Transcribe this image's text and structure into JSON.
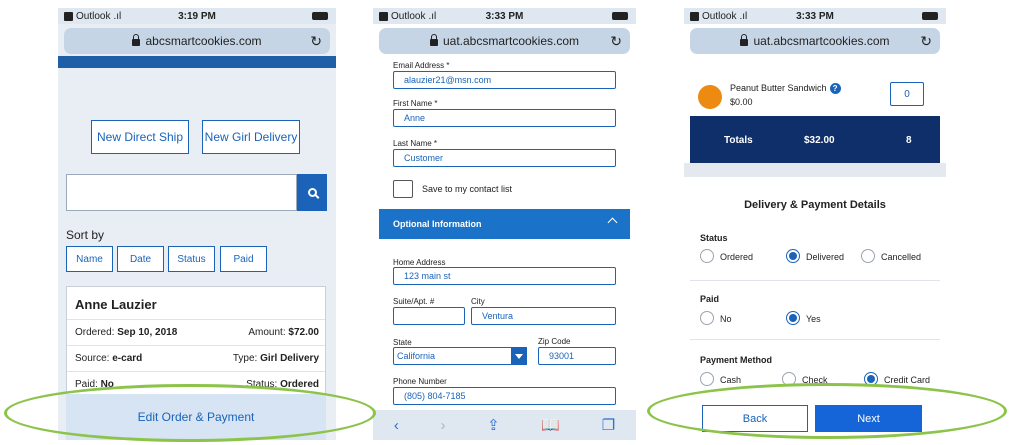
{
  "phone1": {
    "status": {
      "carrier": "Outlook",
      "time": "3:19 PM"
    },
    "url": "abcsmartcookies.com",
    "buttons": {
      "direct_ship": "New Direct Ship",
      "girl_delivery": "New Girl Delivery"
    },
    "search": {
      "placeholder": ""
    },
    "sort": {
      "label": "Sort by",
      "options": [
        "Name",
        "Date",
        "Status",
        "Paid"
      ]
    },
    "order": {
      "name": "Anne Lauzier",
      "ordered_label": "Ordered:",
      "ordered_value": "Sep 10, 2018",
      "amount_label": "Amount:",
      "amount_value": "$72.00",
      "source_label": "Source:",
      "source_value": "e-card",
      "type_label": "Type:",
      "type_value": "Girl Delivery",
      "paid_label": "Paid:",
      "paid_value": "No",
      "status_label": "Status:",
      "status_value": "Ordered"
    },
    "edit_button": "Edit Order & Payment"
  },
  "phone2": {
    "status": {
      "carrier": "Outlook",
      "time": "3:33 PM"
    },
    "url": "uat.abcsmartcookies.com",
    "fields": {
      "email_label": "Email Address *",
      "email_value": "alauzier21@msn.com",
      "first_label": "First Name *",
      "first_value": "Anne",
      "last_label": "Last Name *",
      "last_value": "Customer",
      "save_label": "Save to my contact list",
      "optional_header": "Optional Information",
      "address_label": "Home Address",
      "address_value": "123 main st",
      "suite_label": "Suite/Apt. #",
      "suite_value": "",
      "city_label": "City",
      "city_value": "Ventura",
      "state_label": "State",
      "state_value": "California",
      "zip_label": "Zip Code",
      "zip_value": "93001",
      "phone_label": "Phone Number",
      "phone_value": "(805) 804-7185"
    },
    "toolbar": {
      "back": "‹",
      "forward": "›",
      "share": "⇪",
      "bookmarks": "📖",
      "tabs": "❐"
    }
  },
  "phone3": {
    "status": {
      "carrier": "Outlook",
      "time": "3:33 PM"
    },
    "url": "uat.abcsmartcookies.com",
    "product": {
      "name": "Peanut Butter Sandwich",
      "price": "$0.00",
      "qty": "0",
      "help": "?"
    },
    "totals": {
      "label": "Totals",
      "amount": "$32.00",
      "count": "8"
    },
    "payment": {
      "title": "Delivery & Payment Details",
      "status_label": "Status",
      "status_options": [
        "Ordered",
        "Delivered",
        "Cancelled"
      ],
      "status_selected": "Delivered",
      "paid_label": "Paid",
      "paid_options": [
        "No",
        "Yes"
      ],
      "paid_selected": "Yes",
      "method_label": "Payment Method",
      "method_options": [
        "Cash",
        "Check",
        "Credit Card"
      ],
      "method_selected": "Credit Card"
    },
    "nav": {
      "back": "Back",
      "next": "Next"
    }
  },
  "colors": {
    "accent": "#1a63b9",
    "highlight_ellipse": "#8cc34a",
    "totals_bg": "#0f2f6b",
    "product_dot": "#ec8a12"
  }
}
